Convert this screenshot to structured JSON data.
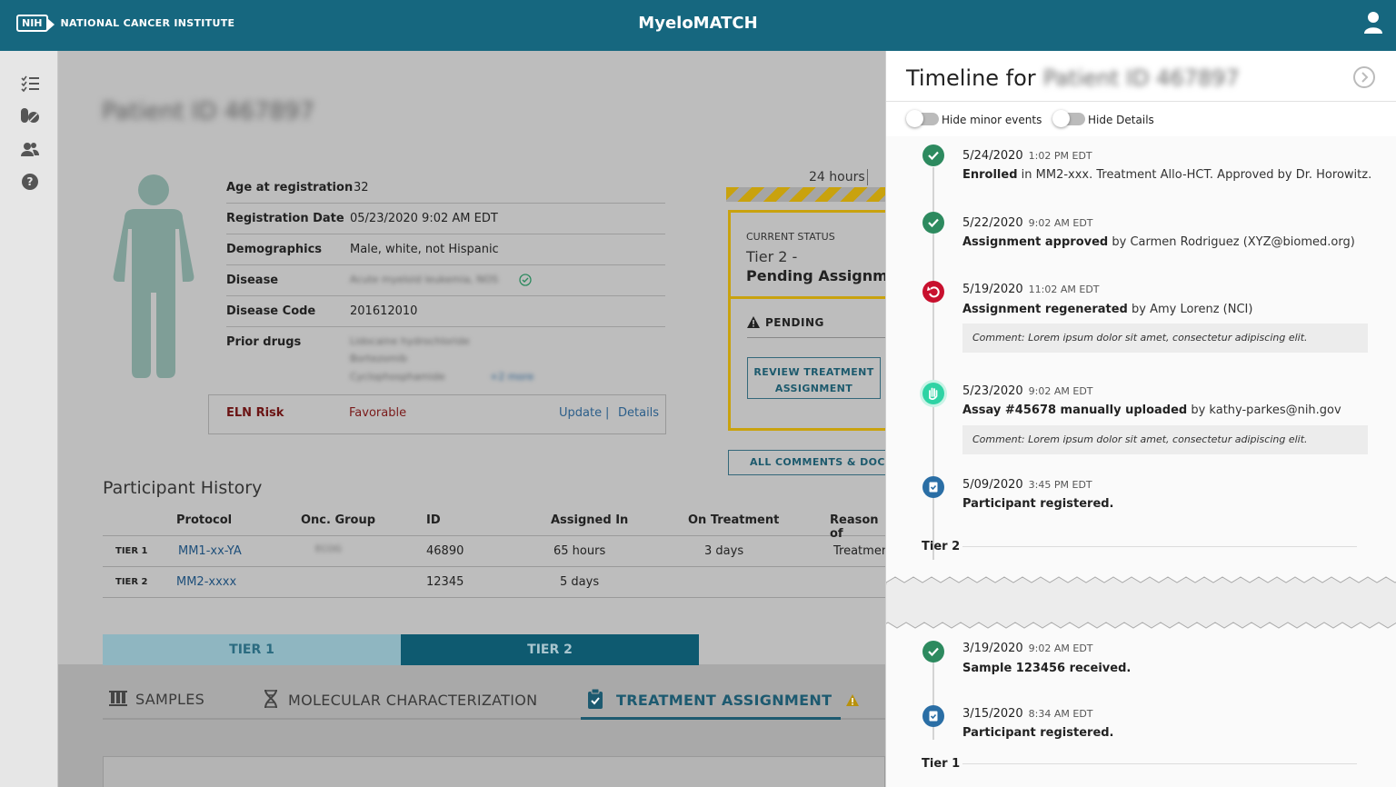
{
  "header": {
    "nih_label": "NIH",
    "org_name": "NATIONAL CANCER INSTITUTE",
    "app_title": "MyeloMATCH"
  },
  "patient": {
    "id_text": "Patient ID 467897",
    "fields": [
      {
        "label": "Age at registration",
        "value": "32"
      },
      {
        "label": "Registration Date",
        "value": "05/23/2020 9:02 AM EDT"
      },
      {
        "label": "Demographics",
        "value": "Male, white, not Hispanic"
      },
      {
        "label": "Disease",
        "value": "Acute myeloid leukemia, NOS"
      },
      {
        "label": "Disease Code",
        "value": "201612010"
      },
      {
        "label": "Prior drugs",
        "value": "Lidocaine hydrochloride"
      }
    ],
    "prior_drugs_more": [
      "Bortezomib",
      "Cyclophosphamide"
    ],
    "prior_drugs_link": "+2 more",
    "eln": {
      "label": "ELN Risk",
      "value": "Favorable",
      "update_link": "Update",
      "separator": "|",
      "details_link": "Details"
    }
  },
  "status": {
    "timer": "24 hours",
    "current_label": "CURRENT STATUS",
    "tier_line": "Tier 2 -",
    "status_line": "Pending Assignment",
    "pending_label": "PENDING",
    "review_button": "REVIEW TREATMENT ASSIGNMENT",
    "comments_button": "ALL COMMENTS & DOCUMENTS"
  },
  "history": {
    "title": "Participant History",
    "columns": [
      "Protocol",
      "Onc. Group",
      "ID",
      "Assigned In",
      "On Treatment",
      "Reason of"
    ],
    "rows": [
      {
        "tier": "TIER 1",
        "protocol": "MM1-xx-YA",
        "group": "ECOG",
        "id": "46890",
        "assigned": "65 hours",
        "on_treatment": "3 days",
        "reason": "Treatment"
      },
      {
        "tier": "TIER 2",
        "protocol": "MM2-xxxx",
        "group": "",
        "id": "12345",
        "assigned": "5 days",
        "on_treatment": "",
        "reason": ""
      }
    ]
  },
  "tier_tabs": [
    "TIER 1",
    "TIER 2"
  ],
  "sub_tabs": {
    "samples": "SAMPLES",
    "molecular": "MOLECULAR CHARACTERIZATION",
    "treatment": "TREATMENT ASSIGNMENT"
  },
  "timeline": {
    "title": "Timeline for",
    "patient_name": "Patient ID 467897",
    "hide_minor": "Hide minor events",
    "hide_details": "Hide Details",
    "events": [
      {
        "date": "5/24/2020",
        "time": "1:02 PM EDT",
        "bold": "Enrolled",
        "rest": " in MM2-xxx. Treatment Allo-HCT. Approved by Dr. Horowitz.",
        "icon": "check-icon",
        "color": "#2d8a5f"
      },
      {
        "date": "5/22/2020",
        "time": "9:02 AM EDT",
        "bold": "Assignment approved",
        "rest": " by Carmen Rodriguez (XYZ@biomed.org)",
        "icon": "check-icon",
        "color": "#2d8a5f"
      },
      {
        "date": "5/19/2020",
        "time": "11:02 AM EDT",
        "bold": "Assignment regenerated",
        "rest": " by Amy Lorenz (NCI)",
        "icon": "undo-icon",
        "color": "#c8102e",
        "comment": "Comment: Lorem ipsum dolor sit amet, consectetur adipiscing elit."
      },
      {
        "date": "5/23/2020",
        "time": "9:02 AM EDT",
        "bold": "Assay #45678 manually uploaded",
        "rest": " by kathy-parkes@nih.gov",
        "icon": "hand-icon",
        "color": "#2ed3a4",
        "comment": "Comment: Lorem ipsum dolor sit amet, consectetur adipiscing elit."
      },
      {
        "date": "5/09/2020",
        "time": "3:45 PM EDT",
        "bold": "Participant registered.",
        "rest": "",
        "icon": "clipboard-icon",
        "color": "#2a6ea5"
      },
      {
        "date": "3/19/2020",
        "time": "9:02 AM EDT",
        "bold": "Sample 123456 received.",
        "rest": "",
        "icon": "check-icon",
        "color": "#2d8a5f"
      },
      {
        "date": "3/15/2020",
        "time": "8:34 AM EDT",
        "bold": "Participant registered.",
        "rest": "",
        "icon": "clipboard-icon",
        "color": "#2a6ea5"
      }
    ],
    "tier2_label": "Tier 2",
    "tier1_label": "Tier 1"
  }
}
